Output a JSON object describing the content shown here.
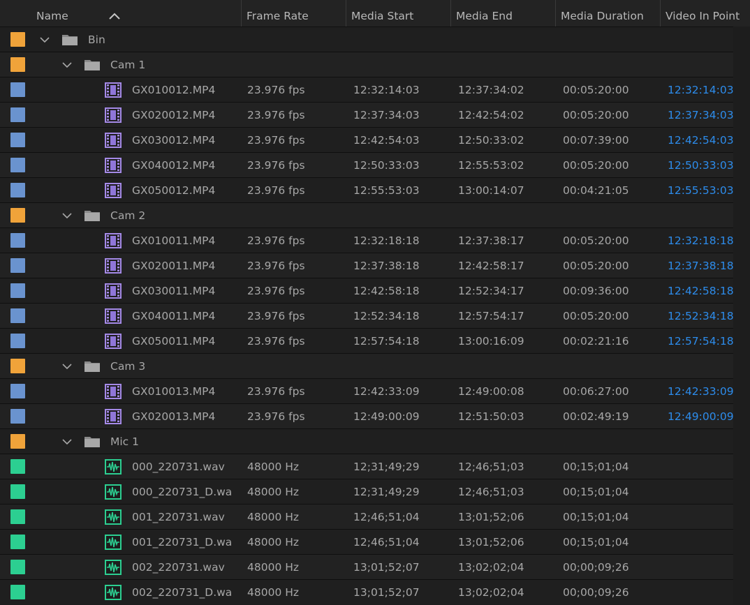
{
  "colors": {
    "folder_label": "#f0a33a",
    "video_label": "#6a93cf",
    "audio_label": "#2ccf91",
    "timecode_link": "#2d8ceb"
  },
  "columns": [
    "Name",
    "Frame Rate",
    "Media Start",
    "Media End",
    "Media Duration",
    "Video In Point"
  ],
  "rows": [
    {
      "kind": "folder",
      "level": 0,
      "name": "Bin"
    },
    {
      "kind": "folder",
      "level": 1,
      "name": "Cam 1"
    },
    {
      "kind": "video",
      "level": 2,
      "name": "GX010012.MP4",
      "rate": "23.976 fps",
      "start": "12:32:14:03",
      "end": "12:37:34:02",
      "dur": "00:05:20:00",
      "inpt": "12:32:14:03"
    },
    {
      "kind": "video",
      "level": 2,
      "name": "GX020012.MP4",
      "rate": "23.976 fps",
      "start": "12:37:34:03",
      "end": "12:42:54:02",
      "dur": "00:05:20:00",
      "inpt": "12:37:34:03"
    },
    {
      "kind": "video",
      "level": 2,
      "name": "GX030012.MP4",
      "rate": "23.976 fps",
      "start": "12:42:54:03",
      "end": "12:50:33:02",
      "dur": "00:07:39:00",
      "inpt": "12:42:54:03"
    },
    {
      "kind": "video",
      "level": 2,
      "name": "GX040012.MP4",
      "rate": "23.976 fps",
      "start": "12:50:33:03",
      "end": "12:55:53:02",
      "dur": "00:05:20:00",
      "inpt": "12:50:33:03"
    },
    {
      "kind": "video",
      "level": 2,
      "name": "GX050012.MP4",
      "rate": "23.976 fps",
      "start": "12:55:53:03",
      "end": "13:00:14:07",
      "dur": "00:04:21:05",
      "inpt": "12:55:53:03"
    },
    {
      "kind": "folder",
      "level": 1,
      "name": "Cam 2"
    },
    {
      "kind": "video",
      "level": 2,
      "name": "GX010011.MP4",
      "rate": "23.976 fps",
      "start": "12:32:18:18",
      "end": "12:37:38:17",
      "dur": "00:05:20:00",
      "inpt": "12:32:18:18"
    },
    {
      "kind": "video",
      "level": 2,
      "name": "GX020011.MP4",
      "rate": "23.976 fps",
      "start": "12:37:38:18",
      "end": "12:42:58:17",
      "dur": "00:05:20:00",
      "inpt": "12:37:38:18"
    },
    {
      "kind": "video",
      "level": 2,
      "name": "GX030011.MP4",
      "rate": "23.976 fps",
      "start": "12:42:58:18",
      "end": "12:52:34:17",
      "dur": "00:09:36:00",
      "inpt": "12:42:58:18"
    },
    {
      "kind": "video",
      "level": 2,
      "name": "GX040011.MP4",
      "rate": "23.976 fps",
      "start": "12:52:34:18",
      "end": "12:57:54:17",
      "dur": "00:05:20:00",
      "inpt": "12:52:34:18"
    },
    {
      "kind": "video",
      "level": 2,
      "name": "GX050011.MP4",
      "rate": "23.976 fps",
      "start": "12:57:54:18",
      "end": "13:00:16:09",
      "dur": "00:02:21:16",
      "inpt": "12:57:54:18"
    },
    {
      "kind": "folder",
      "level": 1,
      "name": "Cam 3"
    },
    {
      "kind": "video",
      "level": 2,
      "name": "GX010013.MP4",
      "rate": "23.976 fps",
      "start": "12:42:33:09",
      "end": "12:49:00:08",
      "dur": "00:06:27:00",
      "inpt": "12:42:33:09"
    },
    {
      "kind": "video",
      "level": 2,
      "name": "GX020013.MP4",
      "rate": "23.976 fps",
      "start": "12:49:00:09",
      "end": "12:51:50:03",
      "dur": "00:02:49:19",
      "inpt": "12:49:00:09"
    },
    {
      "kind": "folder",
      "level": 1,
      "name": "Mic 1"
    },
    {
      "kind": "audio",
      "level": 2,
      "name": "000_220731.wav",
      "rate": "48000 Hz",
      "start": "12;31;49;29",
      "end": "12;46;51;03",
      "dur": "00;15;01;04",
      "inpt": ""
    },
    {
      "kind": "audio",
      "level": 2,
      "name": "000_220731_D.wa",
      "rate": "48000 Hz",
      "start": "12;31;49;29",
      "end": "12;46;51;03",
      "dur": "00;15;01;04",
      "inpt": ""
    },
    {
      "kind": "audio",
      "level": 2,
      "name": "001_220731.wav",
      "rate": "48000 Hz",
      "start": "12;46;51;04",
      "end": "13;01;52;06",
      "dur": "00;15;01;04",
      "inpt": ""
    },
    {
      "kind": "audio",
      "level": 2,
      "name": "001_220731_D.wa",
      "rate": "48000 Hz",
      "start": "12;46;51;04",
      "end": "13;01;52;06",
      "dur": "00;15;01;04",
      "inpt": ""
    },
    {
      "kind": "audio",
      "level": 2,
      "name": "002_220731.wav",
      "rate": "48000 Hz",
      "start": "13;01;52;07",
      "end": "13;02;02;04",
      "dur": "00;00;09;26",
      "inpt": ""
    },
    {
      "kind": "audio",
      "level": 2,
      "name": "002_220731_D.wa",
      "rate": "48000 Hz",
      "start": "13;01;52;07",
      "end": "13;02;02;04",
      "dur": "00;00;09;26",
      "inpt": ""
    }
  ]
}
